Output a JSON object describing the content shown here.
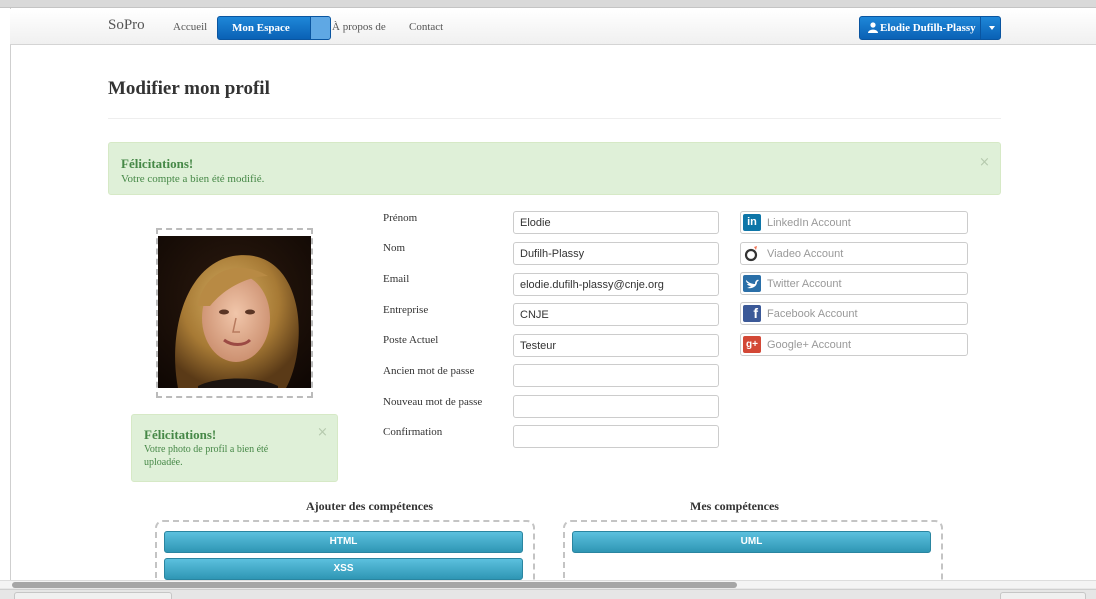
{
  "nav": {
    "brand": "SoPro",
    "items": [
      "Accueil",
      "Mon Espace",
      "À propos de",
      "Contact"
    ],
    "user": "Elodie Dufilh-Plassy"
  },
  "page": {
    "title": "Modifier mon profil"
  },
  "alert_profile": {
    "title": "Félicitations!",
    "message": "Votre compte a bien été modifié.",
    "close": "×"
  },
  "alert_photo": {
    "title": "Félicitations!",
    "message": "Votre photo de profil a bien été uploadée.",
    "close": "×"
  },
  "form": {
    "firstname": {
      "label": "Prénom",
      "value": "Elodie"
    },
    "lastname": {
      "label": "Nom",
      "value": "Dufilh-Plassy"
    },
    "email": {
      "label": "Email",
      "value": "elodie.dufilh-plassy@cnje.org"
    },
    "company": {
      "label": "Entreprise",
      "value": "CNJE"
    },
    "position": {
      "label": "Poste Actuel",
      "value": "Testeur"
    },
    "old_password": {
      "label": "Ancien mot de passe",
      "value": ""
    },
    "new_password": {
      "label": "Nouveau mot de passe",
      "value": ""
    },
    "confirmation": {
      "label": "Confirmation",
      "value": ""
    }
  },
  "social": {
    "linkedin": {
      "placeholder": "LinkedIn Account",
      "color": "#0e76a8",
      "icon": "linkedin-icon"
    },
    "viadeo": {
      "placeholder": "Viadeo Account",
      "color": "#f07355",
      "icon": "viadeo-icon"
    },
    "twitter": {
      "placeholder": "Twitter Account",
      "color": "#2a6fa8",
      "icon": "twitter-icon"
    },
    "facebook": {
      "placeholder": "Facebook Account",
      "color": "#3b5998",
      "icon": "facebook-icon"
    },
    "googleplus": {
      "placeholder": "Google+ Account",
      "color": "#d34836",
      "icon": "googleplus-icon"
    }
  },
  "skills": {
    "add_title": "Ajouter des compétences",
    "mine_title": "Mes compétences",
    "available": [
      "HTML",
      "XSS"
    ],
    "mine": [
      "UML"
    ]
  }
}
